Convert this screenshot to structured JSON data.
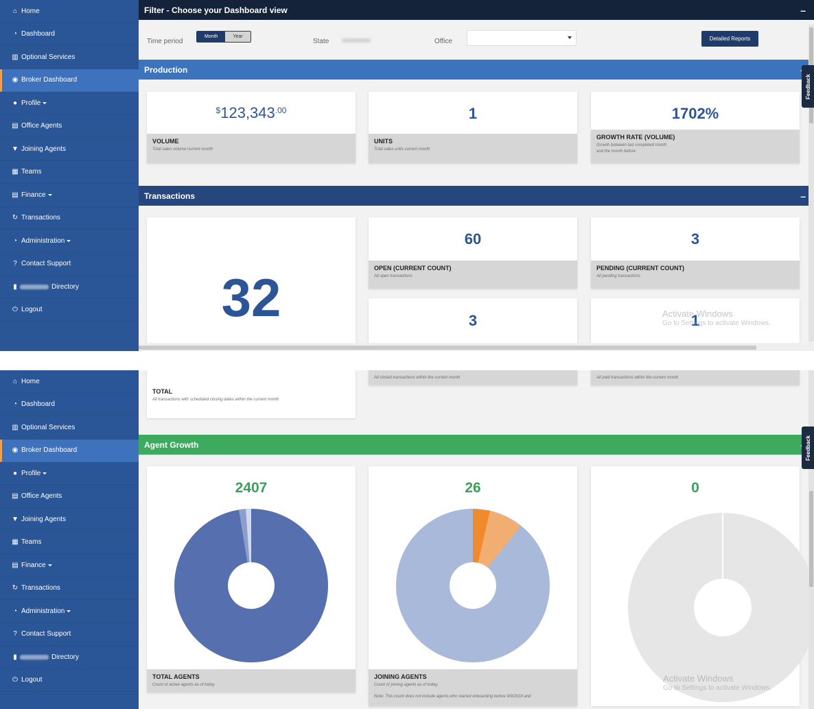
{
  "sidebar": {
    "items": [
      {
        "icon": "home-icon",
        "glyph": "⌂",
        "label": "Home"
      },
      {
        "icon": "dashboard-icon",
        "glyph": "◔",
        "label": "Dashboard"
      },
      {
        "icon": "services-icon",
        "glyph": "▥",
        "label": "Optional Services"
      },
      {
        "icon": "eye-icon",
        "glyph": "◉",
        "label": "Broker Dashboard"
      },
      {
        "icon": "user-icon",
        "glyph": "●",
        "label": "Profile"
      },
      {
        "icon": "list-icon",
        "glyph": "▤",
        "label": "Office Agents"
      },
      {
        "icon": "cart-icon",
        "glyph": "▼",
        "label": "Joining Agents"
      },
      {
        "icon": "grid-icon",
        "glyph": "▦",
        "label": "Teams"
      },
      {
        "icon": "table-icon",
        "glyph": "▤",
        "label": "Finance"
      },
      {
        "icon": "refresh-icon",
        "glyph": "↻",
        "label": "Transactions"
      },
      {
        "icon": "gauge-icon",
        "glyph": "◔",
        "label": "Administration"
      },
      {
        "icon": "question-icon",
        "glyph": "?",
        "label": "Contact Support"
      },
      {
        "icon": "book-icon",
        "glyph": "▮",
        "label": "Directory"
      },
      {
        "icon": "power-icon",
        "glyph": "⏻",
        "label": "Logout"
      }
    ]
  },
  "filter": {
    "title": "Filter - Choose your Dashboard view",
    "time_period_label": "Time period",
    "month": "Month",
    "year": "Year",
    "state_label": "State",
    "office_label": "Office",
    "detailed_reports": "Detailed Reports"
  },
  "production": {
    "title": "Production",
    "volume": {
      "currency": "$",
      "value": "123,343",
      "cents": ".00",
      "label": "VOLUME",
      "desc": "Total sales volume current month"
    },
    "units": {
      "value": "1",
      "label": "UNITS",
      "desc": "Total sales units current month"
    },
    "growth": {
      "value": "1702%",
      "label": "GROWTH RATE (VOLUME)",
      "desc1": "Growth between last completed month",
      "desc2": "and the month before"
    }
  },
  "transactions": {
    "title": "Transactions",
    "total": {
      "value": "32",
      "label": "TOTAL",
      "desc": "All transactions with scheduled closing dates within the current month"
    },
    "open": {
      "value": "60",
      "label": "OPEN (CURRENT COUNT)",
      "desc": "All open transactions"
    },
    "pending": {
      "value": "3",
      "label": "PENDING (CURRENT COUNT)",
      "desc": "All pending transactions"
    },
    "closed": {
      "value": "3",
      "desc": "All closed transactions within the current month"
    },
    "paid": {
      "value": "1",
      "desc": "All paid transactions within the current month"
    }
  },
  "agent_growth": {
    "title": "Agent Growth",
    "total": {
      "value": "2407",
      "label": "TOTAL AGENTS",
      "desc": "Count of active agents as of today"
    },
    "joining": {
      "value": "26",
      "label": "JOINING AGENTS",
      "desc": "Count of joining agents as of today.",
      "note": "Note: This count does not include agents who started onboarding before 9/9/2018 and"
    },
    "third": {
      "value": "0"
    }
  },
  "feedback": "Feedback",
  "watermark": {
    "line1": "Activate Windows",
    "line2": "Go to Settings to activate Windows."
  },
  "colors": {
    "sidebar": "#2a5596",
    "production": "#3b73bd",
    "transactions": "#26477d",
    "agent_growth": "#3daa5e",
    "pie_total": "#566fae",
    "pie_joining": "#a9b9d9",
    "pie_joining_accent": "#f08a2c"
  }
}
